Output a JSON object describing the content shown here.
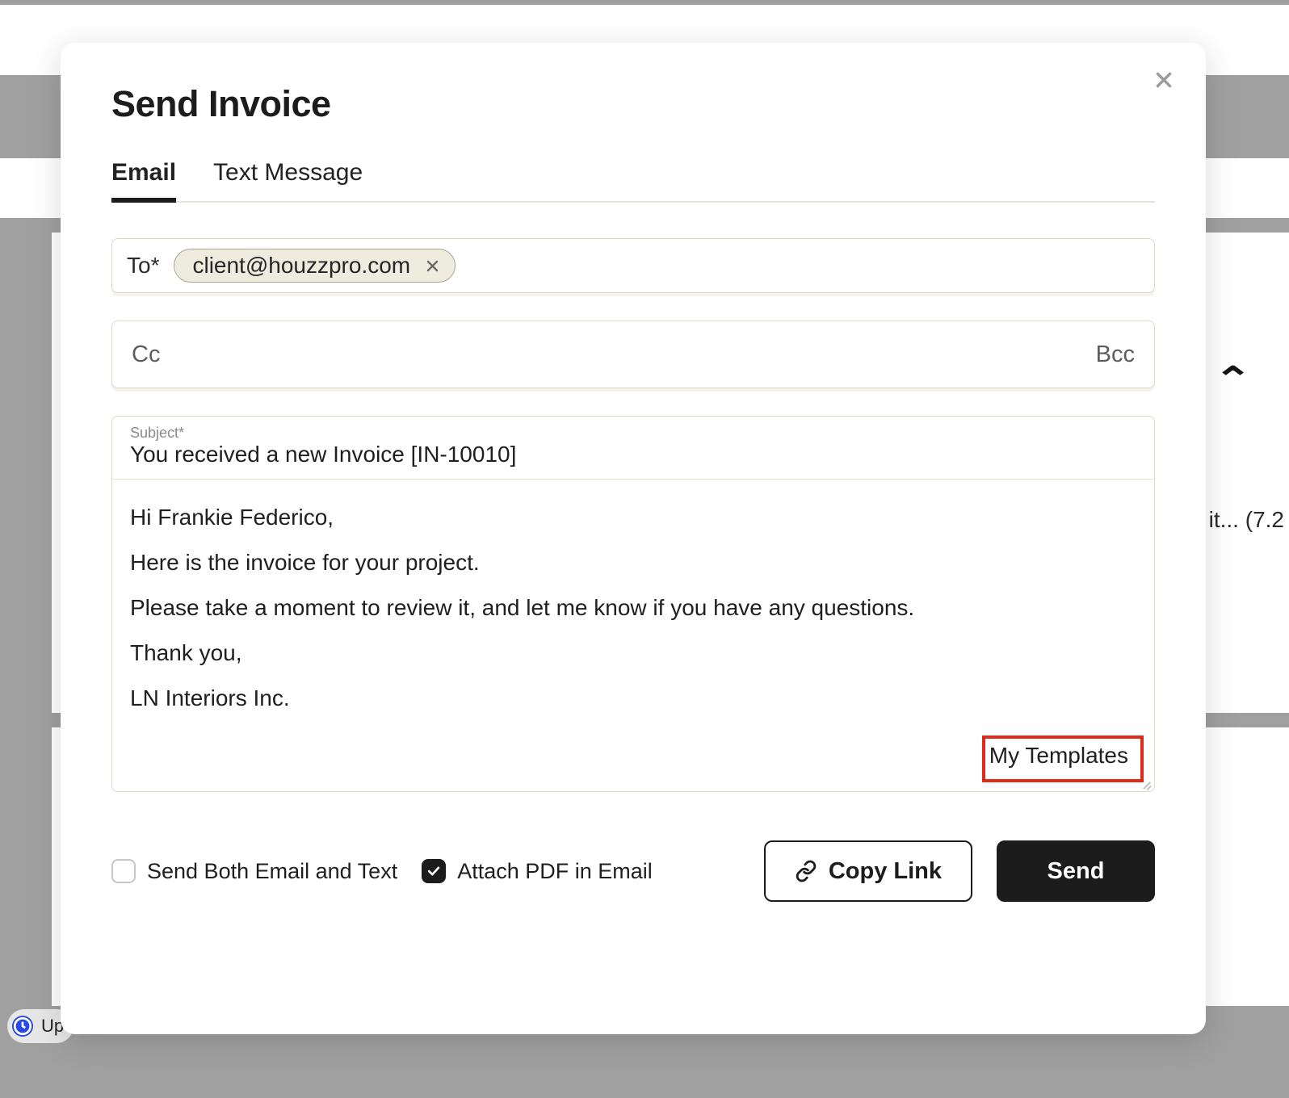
{
  "modal": {
    "title": "Send Invoice",
    "tabs": {
      "email": "Email",
      "text": "Text Message"
    },
    "to_label": "To*",
    "recipient": "client@houzzpro.com",
    "cc_label": "Cc",
    "bcc_label": "Bcc",
    "subject_label": "Subject*",
    "subject_value": "You received a new Invoice [IN-10010]",
    "body": {
      "greeting": "Hi Frankie Federico,",
      "line1": "Here is the invoice for your project.",
      "line2": "Please take a moment to review it, and let me know if you have any questions.",
      "thanks": "Thank you,",
      "signature": "LN Interiors Inc."
    },
    "templates_label": "My Templates",
    "footer": {
      "send_both": "Send Both Email and Text",
      "attach_pdf": "Attach PDF in Email",
      "copy_link": "Copy Link",
      "send": "Send"
    }
  },
  "background": {
    "row_text": "it...  (7.2",
    "pill_text": "Up"
  }
}
